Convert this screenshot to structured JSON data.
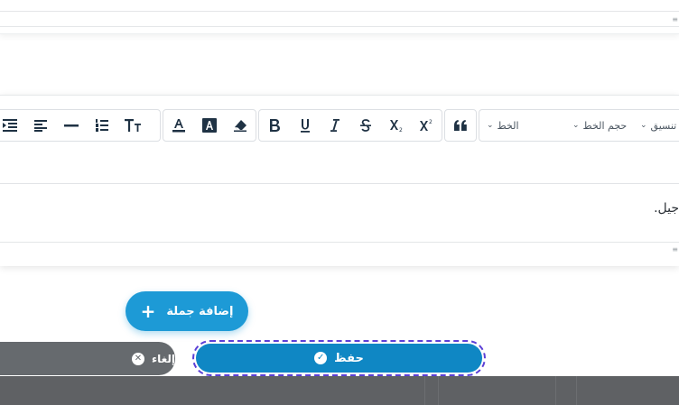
{
  "top_card": {
    "grip": "≡"
  },
  "toolbar": {
    "formatting_select": "تنسيق",
    "font_size_select": "حجم الخط",
    "font_select": "الخط",
    "chevron": "⌄",
    "buttons": {
      "blockquote": "blockquote-icon",
      "superscript": "superscript-icon",
      "subscript": "subscript-icon",
      "strikethrough": "strikethrough-icon",
      "italic": "italic-icon",
      "underline": "underline-icon",
      "bold": "bold-icon",
      "eraser": "eraser-icon",
      "background_color": "text-background-color-icon",
      "font_color": "font-color-icon",
      "text_size": "text-size-icon",
      "ordered_list": "ordered-list-icon",
      "horizontal_rule": "horizontal-rule-icon",
      "align": "align-icon",
      "indent": "indent-icon"
    }
  },
  "editor": {
    "content": "جيل.",
    "grip": "≡"
  },
  "actions": {
    "add_sentence": "إضافة جملة",
    "add_icon": "+",
    "save": "حفظ",
    "save_icon": "✓",
    "cancel": "إلغاء",
    "cancel_icon": "✕"
  },
  "colors": {
    "primary": "#1d9ad6",
    "save": "#0f87c4",
    "cancel": "#666a6e",
    "focus_outline": "#5b3fd6",
    "toolbar_icon": "#1f3244"
  }
}
